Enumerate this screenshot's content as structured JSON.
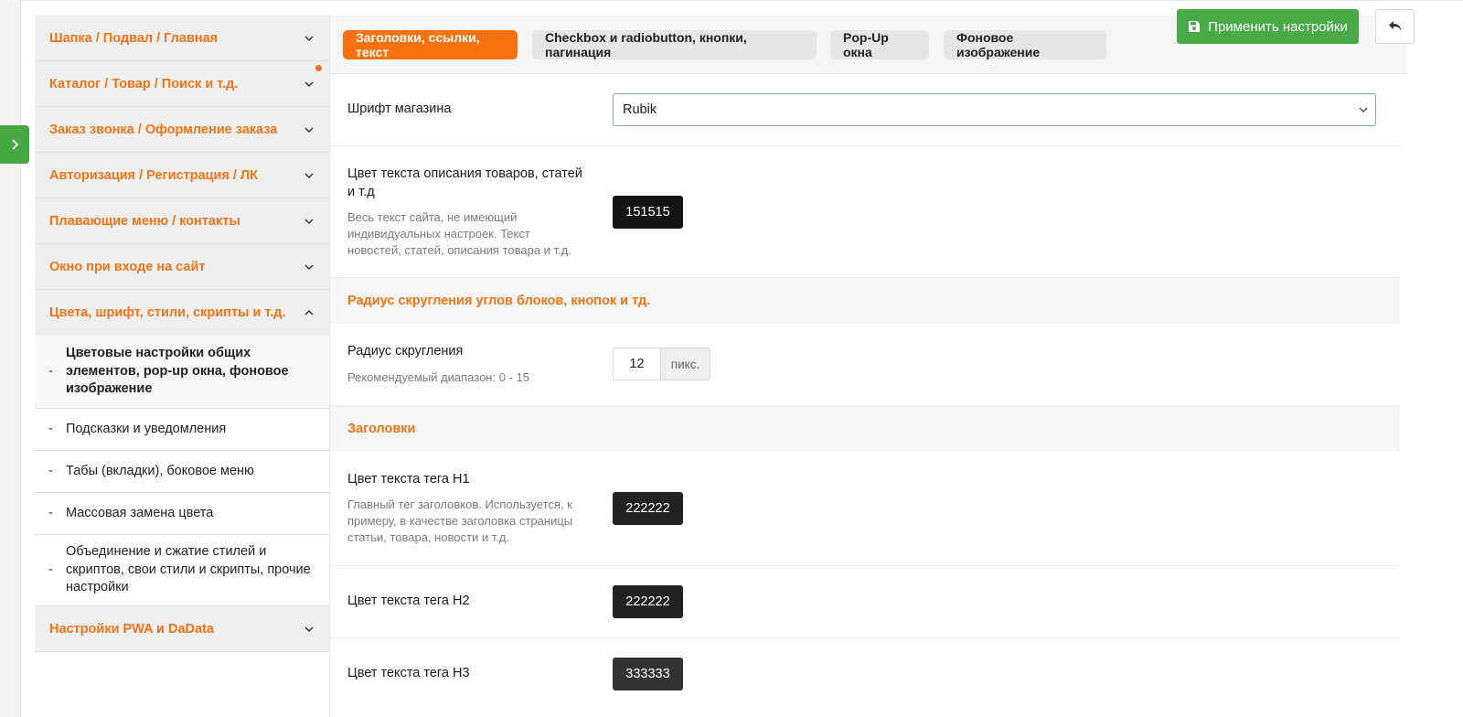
{
  "sidebar": {
    "sections": [
      {
        "label": "Шапка / Подвал / Главная"
      },
      {
        "label": "Каталог / Товар / Поиск и т.д."
      },
      {
        "label": "Заказ звонка / Оформление заказа"
      },
      {
        "label": "Авторизация / Регистрация / ЛК"
      },
      {
        "label": "Плавающие меню / контакты"
      },
      {
        "label": "Окно при входе на сайт"
      },
      {
        "label": "Цвета, шрифт, стили, скрипты и т.д."
      },
      {
        "label": "Настройки PWA и DaData"
      }
    ],
    "subitems": [
      {
        "label": "Цветовые настройки общих элементов, pop-up окна, фоновое изображение"
      },
      {
        "label": "Подсказки и уведомления"
      },
      {
        "label": "Табы (вкладки), боковое меню"
      },
      {
        "label": "Массовая замена цвета"
      },
      {
        "label": "Объединение и сжатие стилей и скриптов, свои стили и скрипты, прочие настройки"
      }
    ],
    "dash": "-"
  },
  "toolbar": {
    "apply_label": "Применить настройки",
    "accent": "#48a947"
  },
  "tabs": [
    {
      "label": "Заголовки, ссылки, текст"
    },
    {
      "label": "Checkbox и radiobutton, кнопки, пагинация"
    },
    {
      "label": "Pop-Up окна"
    },
    {
      "label": "Фоновое изображение"
    }
  ],
  "settings": {
    "font": {
      "label": "Шрифт магазина",
      "value": "Rubik"
    },
    "text_color": {
      "label": "Цвет текста описания товаров, статей и т.д",
      "hint": "Весь текст сайта, не имеющий индивидуальных настроек. Текст новостей, статей, описания товара и т.д.",
      "value": "151515",
      "color": "#151515"
    },
    "radius_section": "Радиус скругления углов блоков, кнопок и тд.",
    "radius": {
      "label": "Радиус скругления",
      "hint": "Рекомендуемый диапазон: 0 - 15",
      "value": "12",
      "unit": "пикс."
    },
    "headings_section": "Заголовки",
    "h1": {
      "label": "Цвет текста тега H1",
      "hint": "Главный тег заголовков. Используется, к примеру, в качестве заголовка страницы статьи, товара, новости и т.д.",
      "value": "222222",
      "color": "#222222"
    },
    "h2": {
      "label": "Цвет текста тега H2",
      "value": "222222",
      "color": "#222222"
    },
    "h3": {
      "label": "Цвет текста тега H3",
      "value": "333333",
      "color": "#333333"
    }
  },
  "colors": {
    "brand_orange": "#f07417",
    "active_tab": "#f7720f"
  }
}
